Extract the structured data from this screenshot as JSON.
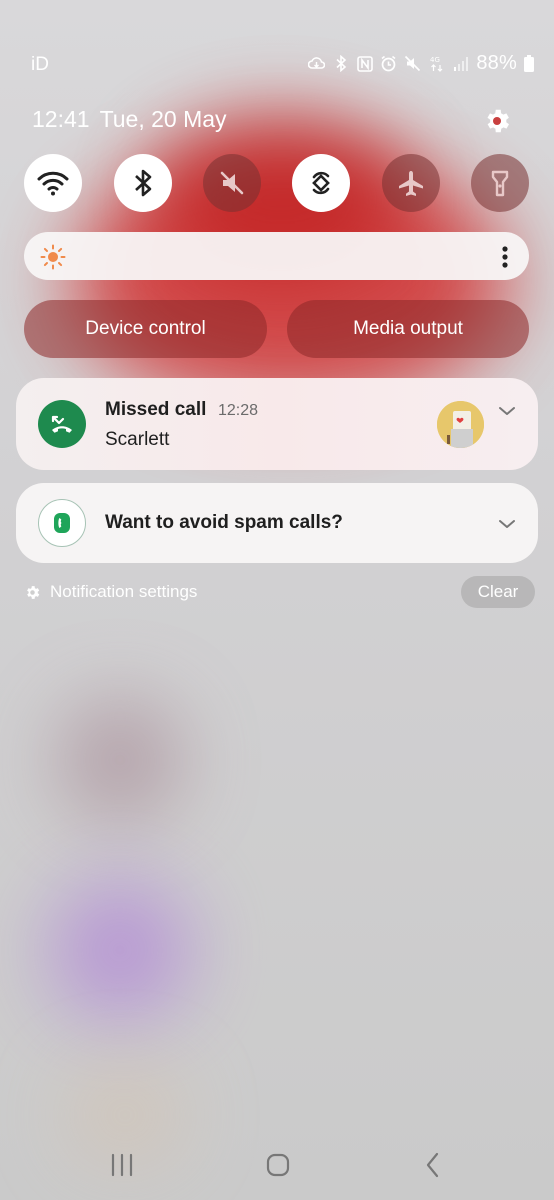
{
  "status_bar": {
    "carrier": "iD",
    "battery": "88%",
    "network": "4G",
    "icons": [
      "cloud-sync-icon",
      "bluetooth-icon",
      "nfc-icon",
      "alarm-icon",
      "mute-icon",
      "network-4g-icon",
      "signal-icon",
      "battery-icon"
    ]
  },
  "header": {
    "time": "12:41",
    "date": "Tue, 20 May"
  },
  "quick_toggles": [
    {
      "name": "wifi",
      "state": "on"
    },
    {
      "name": "bluetooth",
      "state": "on"
    },
    {
      "name": "sound-mute",
      "state": "off"
    },
    {
      "name": "auto-rotate",
      "state": "on"
    },
    {
      "name": "airplane-mode",
      "state": "off"
    },
    {
      "name": "flashlight",
      "state": "off"
    }
  ],
  "brightness": {
    "level": 0.0
  },
  "buttons": {
    "device_control": "Device control",
    "media_output": "Media output"
  },
  "notifications": [
    {
      "app": "phone",
      "title": "Missed call",
      "time": "12:28",
      "body": "Scarlett"
    },
    {
      "app": "phone",
      "title": "Want to avoid spam calls?"
    }
  ],
  "footer": {
    "notification_settings": "Notification settings",
    "clear": "Clear"
  },
  "colors": {
    "accent_red": "#c8262a",
    "phone_green": "#1e8a4e",
    "toggle_on": "#ffffff"
  }
}
